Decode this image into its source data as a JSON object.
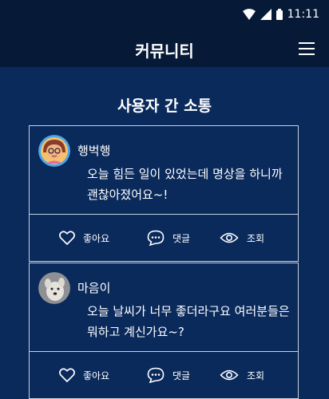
{
  "status": {
    "time": "11:11"
  },
  "appbar": {
    "title": "커뮤니티"
  },
  "section": {
    "title": "사용자 간 소통"
  },
  "posts": [
    {
      "author": "행벅행",
      "content": "오늘 힘든 일이 있었는데 명상을 하니까 괜찮아졌어요~!",
      "actions": {
        "like": "좋아요",
        "comment": "댓글",
        "view": "조회"
      }
    },
    {
      "author": "마음이",
      "content": "오늘 날씨가 너무 좋더라구요 여러분들은 뭐하고 계신가요~?",
      "actions": {
        "like": "좋아요",
        "comment": "댓글",
        "view": "조회"
      }
    }
  ]
}
